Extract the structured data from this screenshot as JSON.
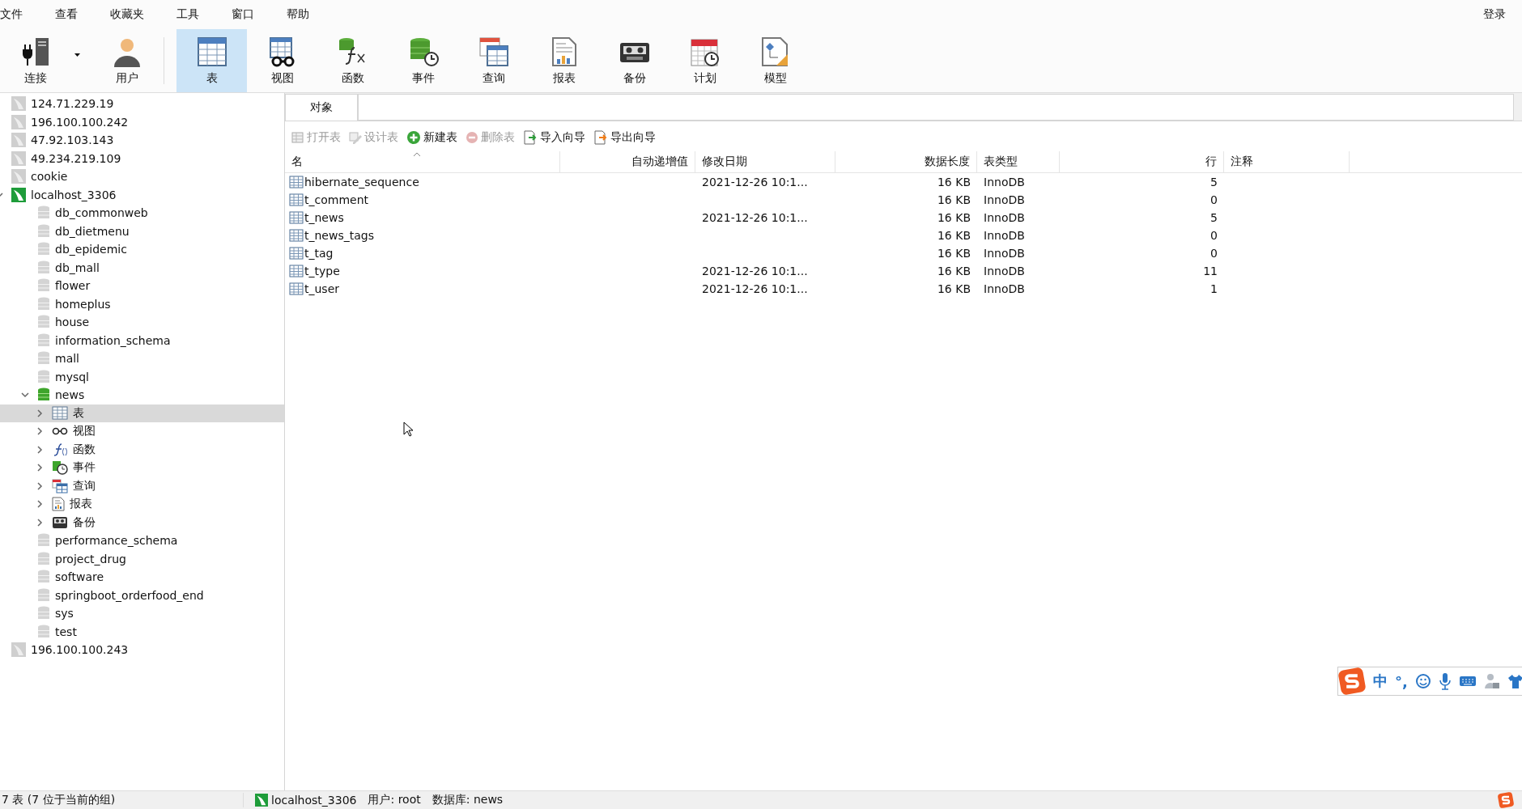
{
  "menu": [
    {
      "label": "文件"
    },
    {
      "label": "查看"
    },
    {
      "label": "收藏夹"
    },
    {
      "label": "工具"
    },
    {
      "label": "窗口"
    },
    {
      "label": "帮助"
    }
  ],
  "account": "登录",
  "toolbar_groups": [
    [
      {
        "label": "连接",
        "kind": "connect",
        "dropdown": true,
        "selected": false
      },
      {
        "label": "用户",
        "kind": "user",
        "selected": false
      }
    ],
    [
      {
        "label": "表",
        "kind": "table",
        "selected": true
      },
      {
        "label": "视图",
        "kind": "view",
        "selected": false
      },
      {
        "label": "函数",
        "kind": "function",
        "selected": false
      },
      {
        "label": "事件",
        "kind": "event",
        "selected": false
      },
      {
        "label": "查询",
        "kind": "query",
        "selected": false
      },
      {
        "label": "报表",
        "kind": "report",
        "selected": false
      },
      {
        "label": "备份",
        "kind": "backup",
        "selected": false
      },
      {
        "label": "计划",
        "kind": "schedule",
        "selected": false
      },
      {
        "label": "模型",
        "kind": "model",
        "selected": false
      }
    ]
  ],
  "tree": [
    {
      "label": "124.71.229.19",
      "kind": "connection",
      "open": false,
      "selected": false
    },
    {
      "label": "196.100.100.242",
      "kind": "connection",
      "open": false,
      "selected": false
    },
    {
      "label": "47.92.103.143",
      "kind": "connection",
      "open": false,
      "selected": false
    },
    {
      "label": "49.234.219.109",
      "kind": "connection",
      "open": false,
      "selected": false
    },
    {
      "label": "cookie",
      "kind": "connection",
      "open": false,
      "selected": false
    },
    {
      "label": "localhost_3306",
      "kind": "connection",
      "open": true,
      "expanded": true,
      "selected": false,
      "children": [
        {
          "label": "db_commonweb",
          "kind": "database",
          "open": false,
          "selected": false
        },
        {
          "label": "db_dietmenu",
          "kind": "database",
          "open": false,
          "selected": false
        },
        {
          "label": "db_epidemic",
          "kind": "database",
          "open": false,
          "selected": false
        },
        {
          "label": "db_mall",
          "kind": "database",
          "open": false,
          "selected": false
        },
        {
          "label": "flower",
          "kind": "database",
          "open": false,
          "selected": false
        },
        {
          "label": "homeplus",
          "kind": "database",
          "open": false,
          "selected": false
        },
        {
          "label": "house",
          "kind": "database",
          "open": false,
          "selected": false
        },
        {
          "label": "information_schema",
          "kind": "database",
          "open": false,
          "selected": false
        },
        {
          "label": "mall",
          "kind": "database",
          "open": false,
          "selected": false
        },
        {
          "label": "mysql",
          "kind": "database",
          "open": false,
          "selected": false
        },
        {
          "label": "news",
          "kind": "database",
          "open": true,
          "expanded": true,
          "selected": false,
          "children": [
            {
              "label": "表",
              "kind": "tables",
              "expanded": false,
              "selected": true
            },
            {
              "label": "视图",
              "kind": "views",
              "expanded": false,
              "selected": false
            },
            {
              "label": "函数",
              "kind": "functions",
              "expanded": false,
              "selected": false
            },
            {
              "label": "事件",
              "kind": "events",
              "expanded": false,
              "selected": false
            },
            {
              "label": "查询",
              "kind": "queries",
              "expanded": false,
              "selected": false
            },
            {
              "label": "报表",
              "kind": "reports",
              "expanded": false,
              "selected": false
            },
            {
              "label": "备份",
              "kind": "backups",
              "expanded": false,
              "selected": false
            }
          ]
        },
        {
          "label": "performance_schema",
          "kind": "database",
          "open": false,
          "selected": false
        },
        {
          "label": "project_drug",
          "kind": "database",
          "open": false,
          "selected": false
        },
        {
          "label": "software",
          "kind": "database",
          "open": false,
          "selected": false
        },
        {
          "label": "springboot_orderfood_end",
          "kind": "database",
          "open": false,
          "selected": false
        },
        {
          "label": "sys",
          "kind": "database",
          "open": false,
          "selected": false
        },
        {
          "label": "test",
          "kind": "database",
          "open": false,
          "selected": false
        }
      ]
    },
    {
      "label": "196.100.100.243",
      "kind": "connection",
      "open": false,
      "selected": false
    }
  ],
  "tabs": [
    {
      "label": "对象",
      "selected": true
    }
  ],
  "actions": [
    {
      "label": "打开表",
      "kind": "open",
      "disabled": true
    },
    {
      "label": "设计表",
      "kind": "design",
      "disabled": true
    },
    {
      "label": "新建表",
      "kind": "new",
      "disabled": false
    },
    {
      "label": "删除表",
      "kind": "delete",
      "disabled": true
    },
    {
      "label": "导入向导",
      "kind": "import",
      "disabled": false
    },
    {
      "label": "导出向导",
      "kind": "export",
      "disabled": false
    }
  ],
  "table": {
    "columns": [
      {
        "label": "名",
        "sorted": true
      },
      {
        "label": "自动递增值"
      },
      {
        "label": "修改日期"
      },
      {
        "label": "数据长度"
      },
      {
        "label": "表类型"
      },
      {
        "label": "行"
      },
      {
        "label": "注释"
      }
    ],
    "rows": [
      {
        "selected": false,
        "cells": [
          "hibernate_sequence",
          "",
          "2021-12-26 10:1...",
          "16 KB",
          "InnoDB",
          "5",
          ""
        ]
      },
      {
        "selected": false,
        "cells": [
          "t_comment",
          "",
          "",
          "16 KB",
          "InnoDB",
          "0",
          ""
        ]
      },
      {
        "selected": false,
        "cells": [
          "t_news",
          "",
          "2021-12-26 10:1...",
          "16 KB",
          "InnoDB",
          "5",
          ""
        ]
      },
      {
        "selected": false,
        "cells": [
          "t_news_tags",
          "",
          "",
          "16 KB",
          "InnoDB",
          "0",
          ""
        ]
      },
      {
        "selected": false,
        "cells": [
          "t_tag",
          "",
          "",
          "16 KB",
          "InnoDB",
          "0",
          ""
        ]
      },
      {
        "selected": false,
        "cells": [
          "t_type",
          "",
          "2021-12-26 10:1...",
          "16 KB",
          "InnoDB",
          "11",
          ""
        ]
      },
      {
        "selected": false,
        "cells": [
          "t_user",
          "",
          "2021-12-26 10:1...",
          "16 KB",
          "InnoDB",
          "1",
          ""
        ]
      }
    ]
  },
  "ime": {
    "mode": "中",
    "punctuation": "°,"
  },
  "status_bar": {
    "summary": "7 表 (7 位于当前的组)",
    "connection": "localhost_3306",
    "user": "用户: root",
    "database": "数据库: news"
  }
}
